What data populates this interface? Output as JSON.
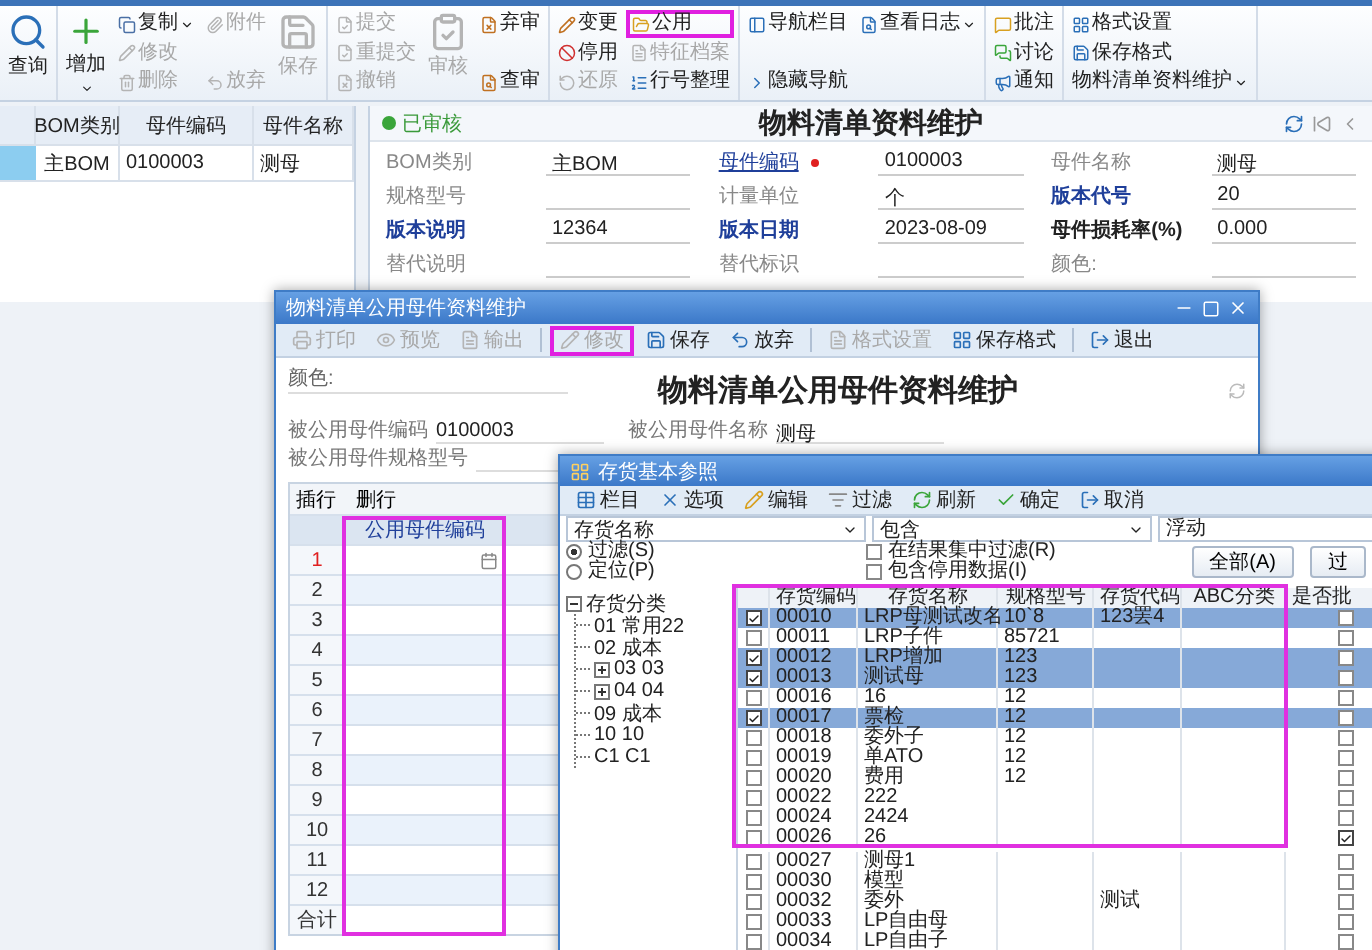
{
  "ribbon": {
    "groups": [
      {
        "columns": [
          [
            {
              "label": "查询",
              "kind": "large",
              "disabled": false,
              "caret": false,
              "annotated": false
            }
          ]
        ]
      },
      {
        "columns": [
          [
            {
              "label": "增加",
              "kind": "large",
              "disabled": false,
              "caret": true,
              "annotated": false
            }
          ],
          [
            {
              "label": "复制",
              "kind": "small",
              "disabled": false,
              "caret": true,
              "annotated": false
            },
            {
              "label": "修改",
              "kind": "small",
              "disabled": true,
              "caret": false,
              "annotated": false
            },
            {
              "label": "删除",
              "kind": "small",
              "disabled": true,
              "caret": false,
              "annotated": false
            }
          ],
          [
            {
              "label": "附件",
              "kind": "small",
              "disabled": true,
              "caret": false,
              "annotated": false
            },
            {
              "label": "放弃",
              "kind": "small",
              "disabled": true,
              "caret": false,
              "annotated": false
            }
          ],
          [
            {
              "label": "保存",
              "kind": "large",
              "disabled": true,
              "caret": false,
              "annotated": false
            }
          ]
        ]
      },
      {
        "columns": [
          [
            {
              "label": "提交",
              "kind": "small",
              "disabled": true,
              "caret": false,
              "annotated": false
            },
            {
              "label": "重提交",
              "kind": "small",
              "disabled": true,
              "caret": false,
              "annotated": false
            },
            {
              "label": "撤销",
              "kind": "small",
              "disabled": true,
              "caret": false,
              "annotated": false
            }
          ],
          [
            {
              "label": "审核",
              "kind": "large",
              "disabled": true,
              "caret": false,
              "annotated": false
            }
          ],
          [
            {
              "label": "弃审",
              "kind": "small",
              "disabled": false,
              "caret": false,
              "annotated": false
            },
            {
              "label": "查审",
              "kind": "small",
              "disabled": false,
              "caret": false,
              "annotated": false
            }
          ]
        ]
      },
      {
        "columns": [
          [
            {
              "label": "变更",
              "kind": "small",
              "disabled": false,
              "caret": false,
              "annotated": false
            },
            {
              "label": "停用",
              "kind": "small",
              "disabled": false,
              "caret": false,
              "annotated": false
            },
            {
              "label": "还原",
              "kind": "small",
              "disabled": true,
              "caret": false,
              "annotated": false
            }
          ],
          [
            {
              "label": "公用",
              "kind": "small",
              "disabled": false,
              "caret": false,
              "annotated": true
            },
            {
              "label": "特征档案",
              "kind": "small",
              "disabled": true,
              "caret": false,
              "annotated": false
            },
            {
              "label": "行号整理",
              "kind": "small",
              "disabled": false,
              "caret": false,
              "annotated": false
            }
          ]
        ]
      },
      {
        "columns": [
          [
            {
              "label": "导航栏目",
              "kind": "small",
              "disabled": false,
              "caret": false,
              "annotated": false
            },
            {
              "label": "隐藏导航",
              "kind": "small",
              "disabled": false,
              "caret": false,
              "annotated": false
            }
          ],
          [
            {
              "label": "查看日志",
              "kind": "small",
              "disabled": false,
              "caret": true,
              "annotated": false
            }
          ]
        ]
      },
      {
        "columns": [
          [
            {
              "label": "批注",
              "kind": "small",
              "disabled": false,
              "caret": false,
              "annotated": false
            },
            {
              "label": "讨论",
              "kind": "small",
              "disabled": false,
              "caret": false,
              "annotated": false
            },
            {
              "label": "通知",
              "kind": "small",
              "disabled": false,
              "caret": false,
              "annotated": false
            }
          ]
        ]
      },
      {
        "columns": [
          [
            {
              "label": "格式设置",
              "kind": "small",
              "disabled": false,
              "caret": false,
              "annotated": false
            },
            {
              "label": "保存格式",
              "kind": "small",
              "disabled": false,
              "caret": false,
              "annotated": false
            },
            {
              "label": "物料清单资料维护",
              "kind": "small",
              "disabled": false,
              "caret": true,
              "annotated": false
            }
          ]
        ]
      }
    ]
  },
  "list_panel": {
    "columns": [
      "BOM类别",
      "母件编码",
      "母件名称"
    ],
    "rows": [
      {
        "cells": [
          "主BOM",
          "0100003",
          "测母"
        ],
        "selected": true
      }
    ]
  },
  "form": {
    "status": "已审核",
    "title": "物料清单资料维护",
    "fields": [
      {
        "label": "BOM类别",
        "value": "主BOM",
        "kind": "plain"
      },
      {
        "label": "母件编码",
        "value": "0100003",
        "kind": "required_link"
      },
      {
        "label": "母件名称",
        "value": "测母",
        "kind": "plain"
      },
      {
        "label": "规格型号",
        "kind": "plain"
      },
      {
        "label": "计量单位",
        "value": "个",
        "kind": "plain"
      },
      {
        "label": "版本代号",
        "value": "20",
        "kind": "blue"
      },
      {
        "label": "版本说明",
        "value": "12364",
        "kind": "blue"
      },
      {
        "label": "版本日期",
        "value": "2023-08-09",
        "kind": "blue"
      },
      {
        "label": "母件损耗率(%)",
        "value": "0.000",
        "kind": "bold"
      },
      {
        "label": "替代说明",
        "kind": "plain"
      },
      {
        "label": "替代标识",
        "kind": "plain"
      },
      {
        "label": "颜色:",
        "kind": "plain"
      }
    ]
  },
  "share_dialog": {
    "title": "物料清单公用母件资料维护",
    "toolbar": [
      [
        {
          "label": "打印",
          "disabled": true,
          "annotated": false
        },
        {
          "label": "预览",
          "disabled": true,
          "annotated": false
        },
        {
          "label": "输出",
          "disabled": true,
          "annotated": false
        }
      ],
      [
        {
          "label": "修改",
          "disabled": true,
          "annotated": true
        },
        {
          "label": "保存",
          "disabled": false,
          "annotated": false
        },
        {
          "label": "放弃",
          "disabled": false,
          "annotated": false
        }
      ],
      [
        {
          "label": "格式设置",
          "disabled": true,
          "annotated": false
        },
        {
          "label": "保存格式",
          "disabled": false,
          "annotated": false
        }
      ],
      [
        {
          "label": "退出",
          "disabled": false,
          "annotated": false
        }
      ]
    ],
    "color_label": "颜色:",
    "heading": "物料清单公用母件资料维护",
    "fields": [
      {
        "label": "被公用母件编码",
        "value": "0100003"
      },
      {
        "label": "被公用母件名称",
        "value": "测母"
      },
      {
        "label": "被公用母件规格型号"
      }
    ],
    "grid": {
      "actions": [
        "插行",
        "删行"
      ],
      "column": "公用母件编码",
      "rows": [
        {
          "number": "1",
          "current": true
        },
        {
          "number": "2",
          "current": false
        },
        {
          "number": "3",
          "current": false
        },
        {
          "number": "4",
          "current": false
        },
        {
          "number": "5",
          "current": false
        },
        {
          "number": "6",
          "current": false
        },
        {
          "number": "7",
          "current": false
        },
        {
          "number": "8",
          "current": false
        },
        {
          "number": "9",
          "current": false
        },
        {
          "number": "10",
          "current": false
        },
        {
          "number": "11",
          "current": false
        },
        {
          "number": "12",
          "current": false
        }
      ],
      "footer": "合计"
    }
  },
  "inventory_dialog": {
    "title": "存货基本参照",
    "toolbar": [
      "栏目",
      "选项",
      "编辑",
      "过滤",
      "刷新",
      "确定",
      "取消"
    ],
    "filter": {
      "field": "存货名称",
      "operator": "包含",
      "value": "浮动",
      "modes": [
        {
          "label": "过滤(S)",
          "selected": true
        },
        {
          "label": "定位(P)",
          "selected": false
        }
      ],
      "options": [
        {
          "label": "在结果集中过滤(R)",
          "checked": false
        },
        {
          "label": "包含停用数据(I)",
          "checked": false
        }
      ],
      "buttons": [
        "全部(A)",
        "过"
      ]
    },
    "tree": {
      "label": "存货分类",
      "expanded": true,
      "children": [
        {
          "label": "01 常用22",
          "kind": "leaf"
        },
        {
          "label": "02 成本",
          "kind": "leaf"
        },
        {
          "label": "03 03",
          "kind": "folder",
          "expanded": false
        },
        {
          "label": "04 04",
          "kind": "folder",
          "expanded": false
        },
        {
          "label": "09 成本",
          "kind": "leaf"
        },
        {
          "label": "10 10",
          "kind": "leaf"
        },
        {
          "label": "C1 C1",
          "kind": "leaf"
        }
      ]
    },
    "table": {
      "columns": [
        "存货编码",
        "存货名称",
        "规格型号",
        "存货代码",
        "ABC分类",
        "是否批"
      ],
      "rows": [
        {
          "code": "00010",
          "name": "LRP母测试改名",
          "spec": "10`8",
          "inv_code": "123罢4",
          "checked": true,
          "selected": true,
          "batch": false
        },
        {
          "code": "00011",
          "name": "LRP子件",
          "spec": "85721",
          "checked": false,
          "selected": false,
          "batch": false
        },
        {
          "code": "00012",
          "name": "LRP增加",
          "spec": "123",
          "checked": true,
          "selected": true,
          "batch": false
        },
        {
          "code": "00013",
          "name": "测试母",
          "spec": "123",
          "checked": true,
          "selected": true,
          "batch": false
        },
        {
          "code": "00016",
          "name": "16",
          "spec": "12",
          "checked": false,
          "selected": false,
          "batch": false
        },
        {
          "code": "00017",
          "name": "票检",
          "spec": "12",
          "checked": true,
          "selected": true,
          "batch": false
        },
        {
          "code": "00018",
          "name": "委外子",
          "spec": "12",
          "checked": false,
          "selected": false,
          "batch": false
        },
        {
          "code": "00019",
          "name": "单ATO",
          "spec": "12",
          "checked": false,
          "selected": false,
          "batch": false
        },
        {
          "code": "00020",
          "name": "费用",
          "spec": "12",
          "checked": false,
          "selected": false,
          "batch": false
        },
        {
          "code": "00022",
          "name": "222",
          "checked": false,
          "selected": false,
          "batch": false
        },
        {
          "code": "00024",
          "name": "2424",
          "checked": false,
          "selected": false,
          "batch": false
        },
        {
          "code": "00026",
          "name": "26",
          "checked": false,
          "selected": false,
          "batch": true
        },
        {
          "code": "00027",
          "name": "测母1",
          "checked": false,
          "selected": false,
          "batch": false
        },
        {
          "code": "00030",
          "name": "模型",
          "checked": false,
          "selected": false,
          "batch": false
        },
        {
          "code": "00032",
          "name": "委外",
          "inv_code": "测试",
          "checked": false,
          "selected": false,
          "batch": false
        },
        {
          "code": "00033",
          "name": "LP自由母",
          "checked": false,
          "selected": false,
          "batch": false
        },
        {
          "code": "00034",
          "name": "LP自由子",
          "checked": false,
          "selected": false,
          "batch": false
        }
      ]
    }
  }
}
